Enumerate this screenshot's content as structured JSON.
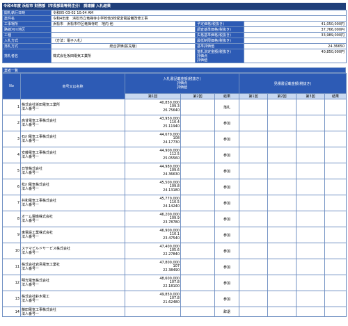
{
  "title": "令和4年度 浜松市 財務部（市長部局等発注分） 調達課 入札結果",
  "info": {
    "open_date_label": "開札執行日時",
    "open_date_value": "令和05-03-02 10:04 AM",
    "project_label": "案件名",
    "project_value": "令和4年度　浜松市立竜禅寺小学校他3校受変電設備改修工事",
    "location_label": "工事場所",
    "location_value": "浜松市　浜松市中区竜禅寺町　地内 他",
    "planned_price_label": "予定価格(税抜き)",
    "planned_price_value": "41,050,000円",
    "region_label": "路線河川地区",
    "survey_base_label": "調査基準価格(税抜き)",
    "survey_base_value": "37,766,000円",
    "trade_label": "工種",
    "min_price_label": "失格基準価格(税抜き)",
    "min_price_value": "33,989,000円",
    "method_label": "入札方式",
    "method_value": "（方法：電子入札）",
    "lowest_limit_label": "最低制限価格(税抜き)",
    "contract_method_label": "落札方式",
    "contract_method_value": "総合評価(拡充版)",
    "base_eval_label": "基準評価值",
    "base_eval_value": "24.36650",
    "winner_label": "落札者名",
    "winner_value": "株式会社坂田電気工業所",
    "winner_amount_label1": "落札決定金額(税抜き)",
    "winner_amount_label2": "評価点",
    "winner_amount_label3": "評価値",
    "winner_amount_value": "40,850,000円"
  },
  "list": {
    "section_title": "業者一覧",
    "col_no": "No",
    "col_name": "商号又は名称",
    "col_bid_group": "入札書記載金額(税抜き)\n評価点\n評価値",
    "col_seen_group": "見積書記載金額(税抜き)",
    "col_round1": "第1回",
    "col_round2": "第2回",
    "col_result": "結果",
    "col_seen1": "第1回",
    "col_seen2": "第2回",
    "col_seen3": "第3回",
    "col_seen_result": "結果",
    "rows": [
      {
        "no": "1",
        "name": "株式会社坂田電気工業所",
        "rep": "法人番号ー",
        "amount": "40,850,000",
        "score": "109.3",
        "value": "26.75640",
        "result": "落札"
      },
      {
        "no": "2",
        "name": "高甘電気工事株式会社",
        "rep": "法人番号ー",
        "amount": "43,950,000",
        "score": "110.4",
        "value": "25.11940",
        "result": "参加"
      },
      {
        "no": "3",
        "name": "石川電気工事株式会社",
        "rep": "法人番号ー",
        "amount": "44,670,000",
        "score": "108",
        "value": "24.17730",
        "result": "参加"
      },
      {
        "no": "4",
        "name": "安藤電気工事株式会社",
        "rep": "法人番号ー",
        "amount": "44,900,000",
        "score": "112.5",
        "value": "25.05560",
        "result": "参加"
      },
      {
        "no": "5",
        "name": "日管株式会社",
        "rep": "法人番号ー",
        "amount": "44,980,000",
        "score": "109.6",
        "value": "24.36630",
        "result": "参加"
      },
      {
        "no": "6",
        "name": "松川電気株式会社",
        "rep": "法人番号ー",
        "amount": "45,500,000",
        "score": "109.8",
        "value": "24.13180",
        "result": "参加"
      },
      {
        "no": "7",
        "name": "共和電気工事株式会社",
        "rep": "法人番号ー",
        "amount": "45,770,000",
        "score": "110.5",
        "value": "24.14240",
        "result": "参加"
      },
      {
        "no": "8",
        "name": "オーム電機株式会社",
        "rep": "法人番号ー",
        "amount": "46,200,000",
        "score": "109.9",
        "value": "23.78780",
        "result": "参加"
      },
      {
        "no": "9",
        "name": "東電設工業株式会社",
        "rep": "法人番号ー",
        "amount": "46,900,000",
        "score": "110.1",
        "value": "23.47540",
        "result": "参加"
      },
      {
        "no": "10",
        "name": "スヤマビルドサービス株式会社",
        "rep": "法人番号ー",
        "amount": "47,400,000",
        "score": "105.6",
        "value": "22.27840",
        "result": "参加"
      },
      {
        "no": "11",
        "name": "株式会社岩島電気工業社",
        "rep": "法人番号ー",
        "amount": "47,800,000",
        "score": "107",
        "value": "22.38490",
        "result": "参加"
      },
      {
        "no": "12",
        "name": "明光電気株式会社",
        "rep": "法人番号ー",
        "amount": "48,600,000",
        "score": "107.8",
        "value": "22.18100",
        "result": "参加"
      },
      {
        "no": "13",
        "name": "株式会社鈴木電工",
        "rep": "法人番号ー",
        "amount": "49,850,000",
        "score": "107.8",
        "value": "21.62480",
        "result": "参加"
      },
      {
        "no": "14",
        "name": "藤田電気工事株式会社",
        "rep": "法人番号ー",
        "amount": "",
        "score": "",
        "value": "",
        "result": "辞退"
      }
    ]
  },
  "colors": {
    "header_bg": "#2d5bb5",
    "title_bg": "#1f3f7a",
    "border": "#6f8fc2",
    "subheader_bg": "#c8d8f0"
  }
}
